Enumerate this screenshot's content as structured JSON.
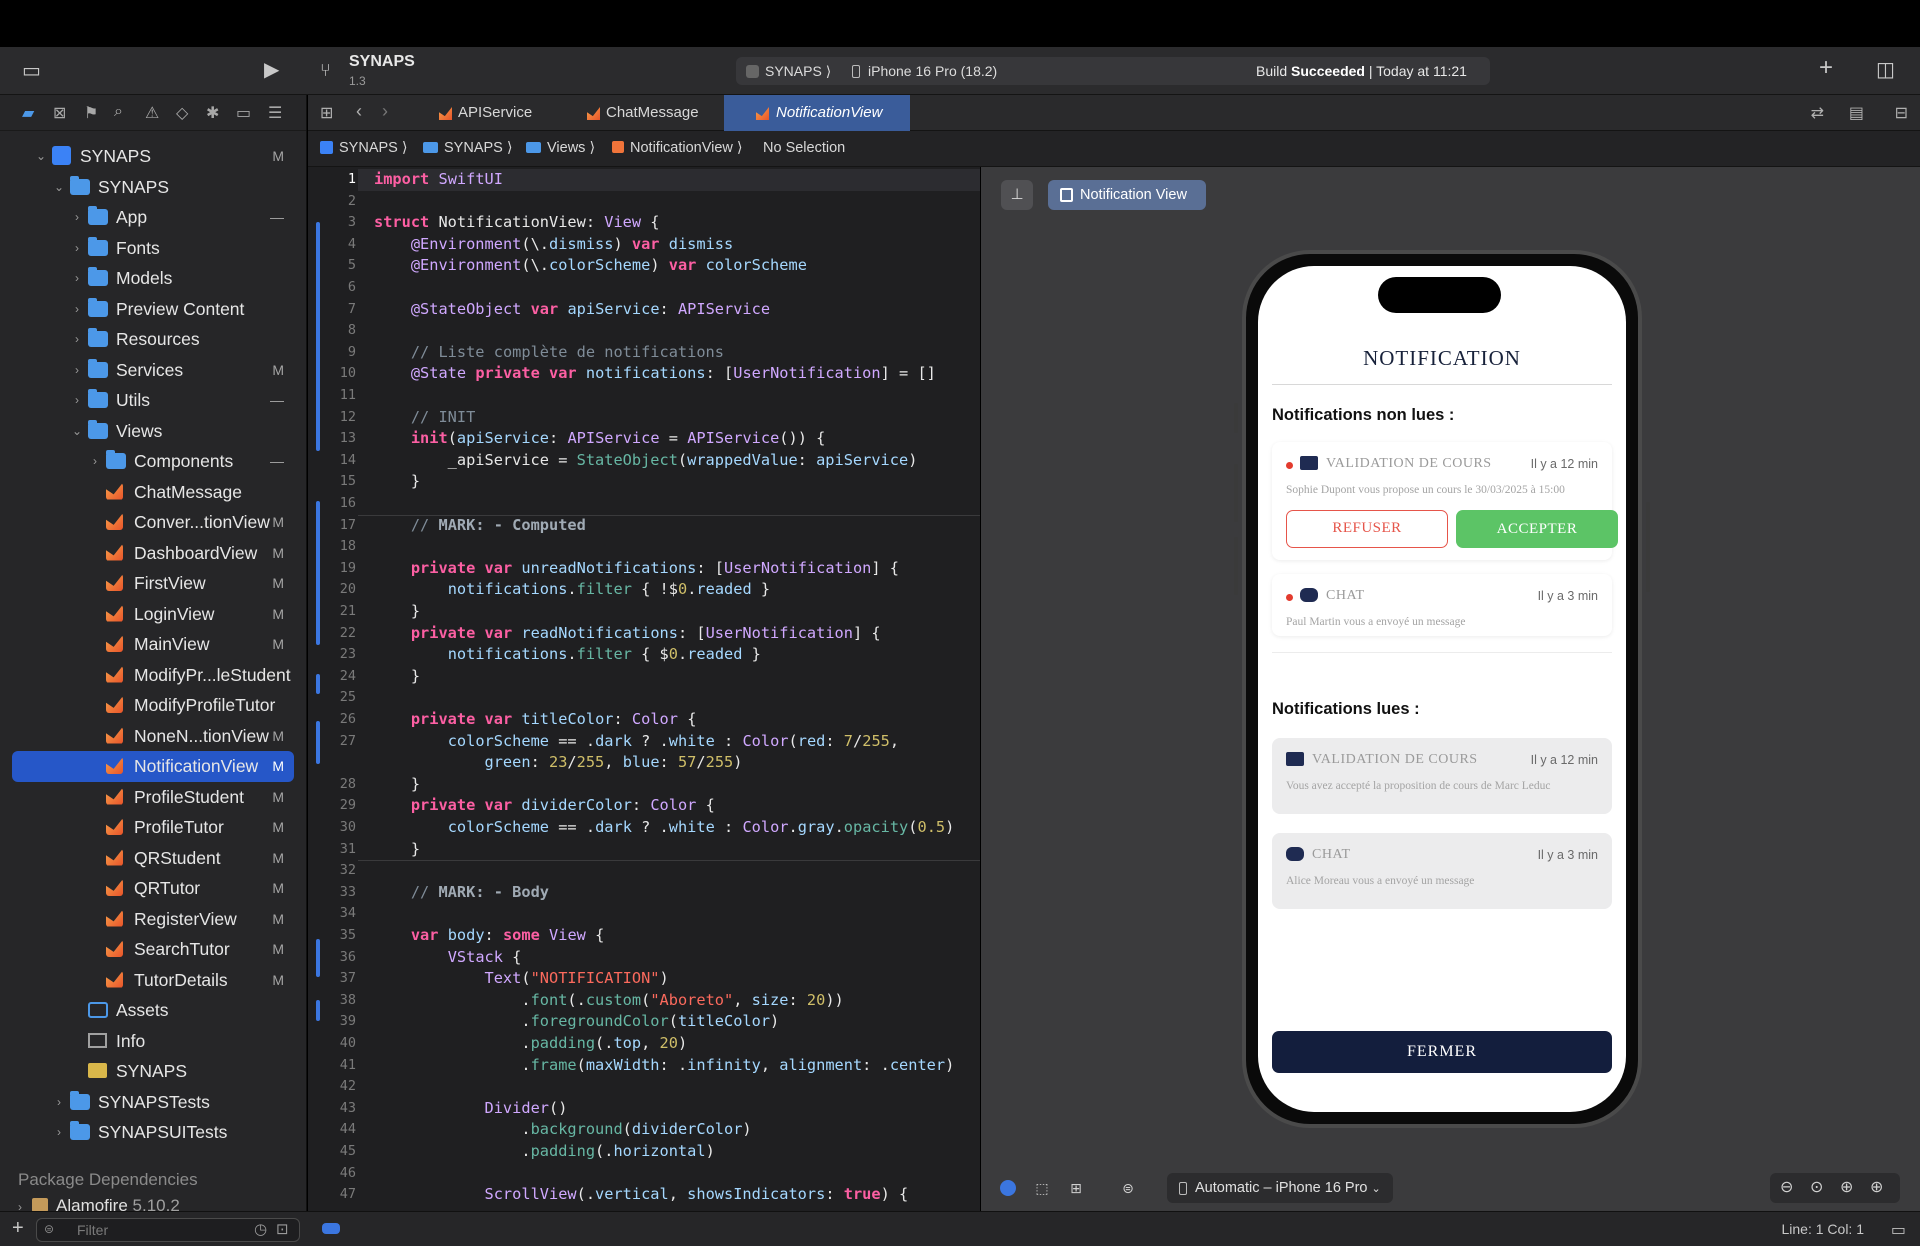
{
  "toolbar": {
    "project_name": "SYNAPS",
    "project_version": "1.3",
    "scheme": "SYNAPS",
    "device": "iPhone 16 Pro (18.2)",
    "build_status_prefix": "Build ",
    "build_status_bold": "Succeeded",
    "build_status_suffix": " | Today at 11:21"
  },
  "navigator": {
    "tree": [
      {
        "label": "SYNAPS",
        "icon": "project-icon",
        "depth": 0,
        "open": true,
        "badge": "M"
      },
      {
        "label": "SYNAPS",
        "icon": "folder-icon",
        "depth": 1,
        "open": true,
        "badge": ""
      },
      {
        "label": "App",
        "icon": "folder-icon",
        "depth": 2,
        "open": false,
        "badge": "—"
      },
      {
        "label": "Fonts",
        "icon": "folder-icon",
        "depth": 2,
        "open": false,
        "badge": ""
      },
      {
        "label": "Models",
        "icon": "folder-icon",
        "depth": 2,
        "open": false,
        "badge": ""
      },
      {
        "label": "Preview Content",
        "icon": "folder-icon",
        "depth": 2,
        "open": false,
        "badge": ""
      },
      {
        "label": "Resources",
        "icon": "folder-icon",
        "depth": 2,
        "open": false,
        "badge": ""
      },
      {
        "label": "Services",
        "icon": "folder-icon",
        "depth": 2,
        "open": false,
        "badge": "M"
      },
      {
        "label": "Utils",
        "icon": "folder-icon",
        "depth": 2,
        "open": false,
        "badge": "—"
      },
      {
        "label": "Views",
        "icon": "folder-icon",
        "depth": 2,
        "open": true,
        "badge": ""
      },
      {
        "label": "Components",
        "icon": "folder-icon",
        "depth": 3,
        "open": false,
        "badge": "—"
      },
      {
        "label": "ChatMessage",
        "icon": "swift-file-icon",
        "depth": 3,
        "badge": ""
      },
      {
        "label": "Conver...tionView",
        "icon": "swift-file-icon",
        "depth": 3,
        "badge": "M"
      },
      {
        "label": "DashboardView",
        "icon": "swift-file-icon",
        "depth": 3,
        "badge": "M"
      },
      {
        "label": "FirstView",
        "icon": "swift-file-icon",
        "depth": 3,
        "badge": "M"
      },
      {
        "label": "LoginView",
        "icon": "swift-file-icon",
        "depth": 3,
        "badge": "M"
      },
      {
        "label": "MainView",
        "icon": "swift-file-icon",
        "depth": 3,
        "badge": "M"
      },
      {
        "label": "ModifyPr...leStudent",
        "icon": "swift-file-icon",
        "depth": 3,
        "badge": ""
      },
      {
        "label": "ModifyProfileTutor",
        "icon": "swift-file-icon",
        "depth": 3,
        "badge": ""
      },
      {
        "label": "NoneN...tionView",
        "icon": "swift-file-icon",
        "depth": 3,
        "badge": "M"
      },
      {
        "label": "NotificationView",
        "icon": "swift-file-icon",
        "depth": 3,
        "badge": "M",
        "selected": true
      },
      {
        "label": "ProfileStudent",
        "icon": "swift-file-icon",
        "depth": 3,
        "badge": "M"
      },
      {
        "label": "ProfileTutor",
        "icon": "swift-file-icon",
        "depth": 3,
        "badge": "M"
      },
      {
        "label": "QRStudent",
        "icon": "swift-file-icon",
        "depth": 3,
        "badge": "M"
      },
      {
        "label": "QRTutor",
        "icon": "swift-file-icon",
        "depth": 3,
        "badge": "M"
      },
      {
        "label": "RegisterView",
        "icon": "swift-file-icon",
        "depth": 3,
        "badge": "M"
      },
      {
        "label": "SearchTutor",
        "icon": "swift-file-icon",
        "depth": 3,
        "badge": "M"
      },
      {
        "label": "TutorDetails",
        "icon": "swift-file-icon",
        "depth": 3,
        "badge": "M"
      },
      {
        "label": "Assets",
        "icon": "assets-icon",
        "depth": 2,
        "badge": ""
      },
      {
        "label": "Info",
        "icon": "info-table-icon",
        "depth": 2,
        "badge": ""
      },
      {
        "label": "SYNAPS",
        "icon": "entitlements-icon",
        "depth": 2,
        "badge": ""
      },
      {
        "label": "SYNAPSTests",
        "icon": "folder-icon",
        "depth": 1,
        "open": false,
        "badge": ""
      },
      {
        "label": "SYNAPSUITests",
        "icon": "folder-icon",
        "depth": 1,
        "open": false,
        "badge": ""
      }
    ],
    "packages_header": "Package Dependencies",
    "package_name": "Alamofire",
    "package_version": "5.10.2",
    "filter_placeholder": "Filter"
  },
  "tabs": [
    {
      "label": "APIService"
    },
    {
      "label": "ChatMessage"
    },
    {
      "label": "NotificationView",
      "active": true
    }
  ],
  "breadcrumb": [
    "SYNAPS",
    "SYNAPS",
    "Views",
    "NotificationView",
    "No Selection"
  ],
  "editor": {
    "current_line": 1,
    "lines": [
      "import SwiftUI",
      "",
      "struct NotificationView: View {",
      "    @Environment(\\.dismiss) var dismiss",
      "    @Environment(\\.colorScheme) var colorScheme",
      "",
      "    @StateObject var apiService: APIService",
      "",
      "    // Liste complète de notifications",
      "    @State private var notifications: [UserNotification] = []",
      "",
      "    // INIT",
      "    init(apiService: APIService = APIService()) {",
      "        _apiService = StateObject(wrappedValue: apiService)",
      "    }",
      "",
      "    // MARK: - Computed",
      "",
      "    private var unreadNotifications: [UserNotification] {",
      "        notifications.filter { !$0.readed }",
      "    }",
      "    private var readNotifications: [UserNotification] {",
      "        notifications.filter { $0.readed }",
      "    }",
      "",
      "    private var titleColor: Color {",
      "        colorScheme == .dark ? .white : Color(red: 7/255,",
      "            green: 23/255, blue: 57/255)",
      "    }",
      "    private var dividerColor: Color {",
      "        colorScheme == .dark ? .white : Color.gray.opacity(0.5)",
      "    }",
      "",
      "    // MARK: - Body",
      "",
      "    var body: some View {",
      "        VStack {",
      "            Text(\"NOTIFICATION\")",
      "                .font(.custom(\"Aboreto\", size: 20))",
      "                .foregroundColor(titleColor)",
      "                .padding(.top, 20)",
      "                .frame(maxWidth: .infinity, alignment: .center)",
      "",
      "            Divider()",
      "                .background(dividerColor)",
      "                .padding(.horizontal)",
      "",
      "            ScrollView(.vertical, showsIndicators: true) {"
    ],
    "line_numbers": [
      "1",
      "2",
      "3",
      "4",
      "5",
      "6",
      "7",
      "8",
      "9",
      "10",
      "11",
      "12",
      "13",
      "14",
      "15",
      "16",
      "17",
      "18",
      "19",
      "20",
      "21",
      "22",
      "23",
      "24",
      "25",
      "26",
      "27",
      "",
      "28",
      "29",
      "30",
      "31",
      "32",
      "33",
      "34",
      "35",
      "36",
      "37",
      "38",
      "39",
      "40",
      "41",
      "42",
      "43",
      "44",
      "45",
      "46",
      "47"
    ]
  },
  "canvas": {
    "preview_chip": "Notification View",
    "device_selector": "Automatic – iPhone 16 Pro"
  },
  "preview": {
    "title": "NOTIFICATION",
    "unread_header": "Notifications non lues :",
    "read_header": "Notifications lues :",
    "unread": [
      {
        "type": "VALIDATION DE COURS",
        "time": "Il y a 12 min",
        "body": "Sophie Dupont vous propose un cours le 30/03/2025 à 15:00",
        "icon": "book-icon"
      },
      {
        "type": "CHAT",
        "time": "Il y a 3 min",
        "body": "Paul Martin vous a envoyé un message",
        "icon": "chat-bubble-icon"
      }
    ],
    "read": [
      {
        "type": "VALIDATION DE COURS",
        "time": "Il y a 12 min",
        "body": "Vous avez accepté la proposition de cours de Marc Leduc",
        "icon": "book-icon"
      },
      {
        "type": "CHAT",
        "time": "Il y a 3 min",
        "body": "Alice Moreau vous a envoyé un message",
        "icon": "chat-bubble-icon"
      }
    ],
    "refuse_label": "REFUSER",
    "accept_label": "ACCEPTER",
    "close_label": "FERMER"
  },
  "status": {
    "cursor": "Line: 1  Col: 1"
  },
  "colors": {
    "accent_selection": "#2657c8",
    "refuse_red": "#e6554a",
    "accept_green": "#5cc466",
    "close_navy": "#131e3d"
  }
}
